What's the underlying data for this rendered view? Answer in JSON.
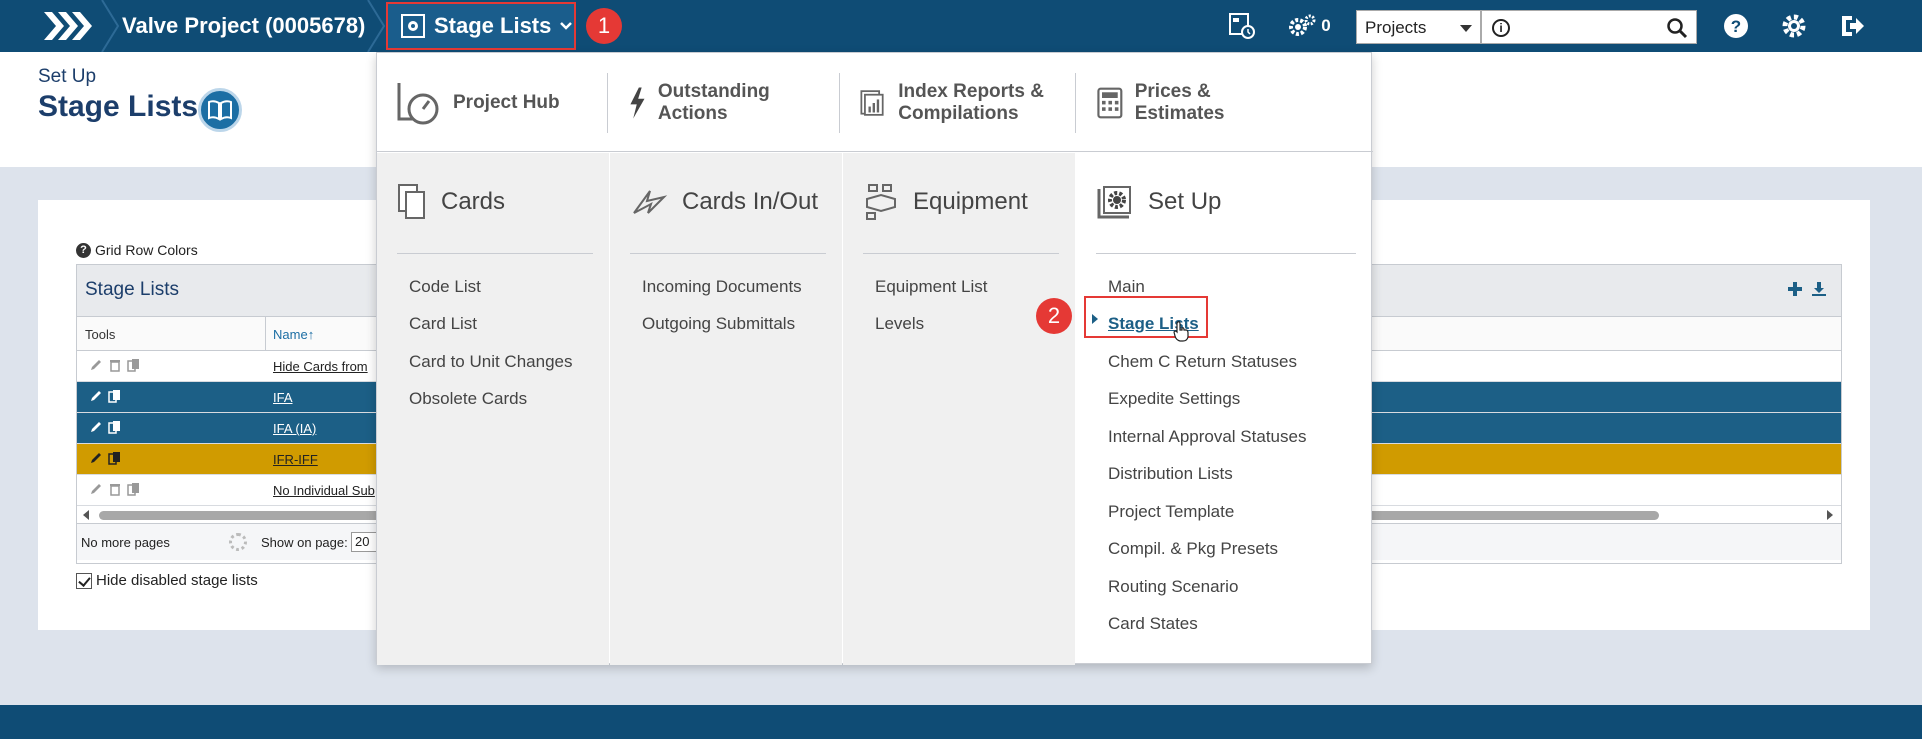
{
  "topbar": {
    "project_title": "Valve Project (0005678)",
    "menu_label": "Stage Lists",
    "badge_1": "1",
    "gear_count": "0",
    "search_scope": "Projects",
    "search_placeholder": "",
    "colors": {
      "bar": "#0f4c75",
      "highlight": "#e53935"
    }
  },
  "header": {
    "section": "Set Up",
    "title": "Stage Lists"
  },
  "grid": {
    "legend_label": "Grid Row Colors",
    "title": "Stage Lists",
    "columns": {
      "tools": "Tools",
      "name": "Name"
    },
    "rows": [
      {
        "name": "Hide Cards from",
        "style": "white"
      },
      {
        "name": "IFA",
        "style": "blue"
      },
      {
        "name": "IFA (IA)",
        "style": "blue"
      },
      {
        "name": "IFR-IFF",
        "style": "gold"
      },
      {
        "name": "No Individual Sub",
        "style": "white"
      }
    ],
    "pager": {
      "no_more": "No more pages",
      "show_on_page": "Show on page:",
      "page_size": "20"
    },
    "hide_disabled": "Hide disabled stage lists"
  },
  "mega_menu": {
    "top": [
      {
        "label": "Project Hub",
        "icon": "gauge-icon"
      },
      {
        "label": "Outstanding Actions",
        "icon": "lightning-icon"
      },
      {
        "label": "Index Reports & Compilations",
        "icon": "report-icon"
      },
      {
        "label": "Prices & Estimates",
        "icon": "calculator-icon"
      }
    ],
    "columns": [
      {
        "heading": "Cards",
        "items": [
          "Code List",
          "Card List",
          "Card to Unit Changes",
          "Obsolete Cards"
        ]
      },
      {
        "heading": "Cards In/Out",
        "items": [
          "Incoming Documents",
          "Outgoing Submittals"
        ]
      },
      {
        "heading": "Equipment",
        "items": [
          "Equipment List",
          "Levels"
        ]
      },
      {
        "heading": "Set Up",
        "items": [
          "Main",
          "Stage Lists",
          "Chem C Return Statuses",
          "Expedite Settings",
          "Internal Approval Statuses",
          "Distribution Lists",
          "Project Template",
          "Compil. & Pkg Presets",
          "Routing Scenario",
          "Card States"
        ]
      }
    ],
    "badge_2": "2"
  }
}
